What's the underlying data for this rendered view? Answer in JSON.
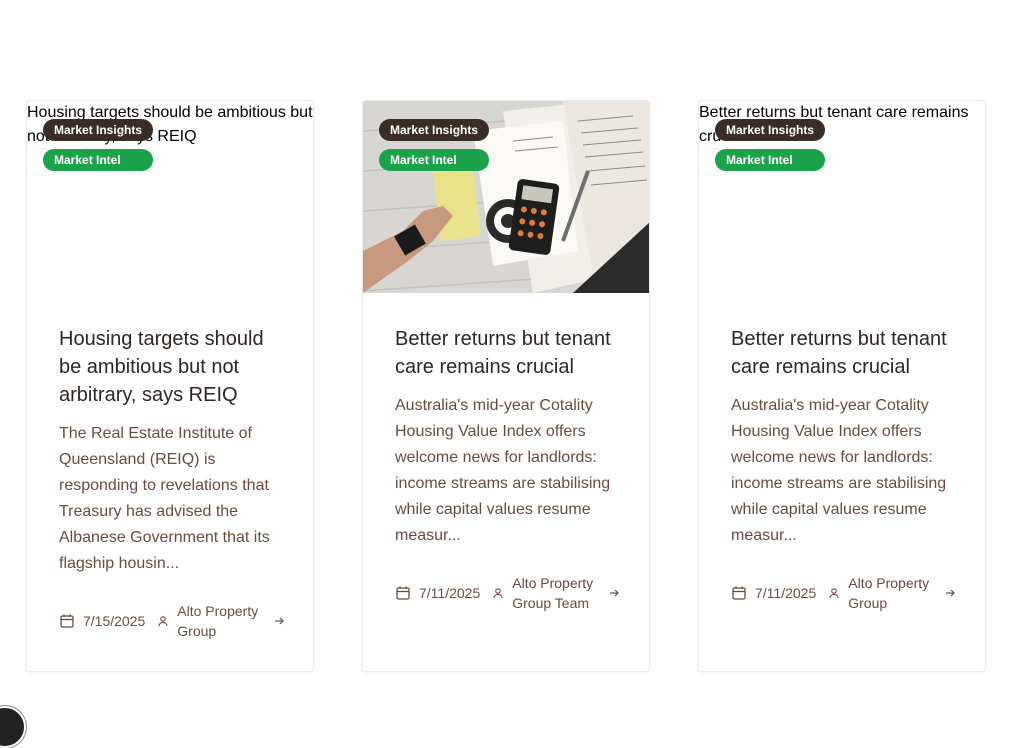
{
  "cards": [
    {
      "image_alt": "Housing targets should be ambitious but not arbitrary, says REIQ",
      "badge_category": "Market Insights",
      "badge_tag": "Market Intel",
      "title": "Housing targets should be ambitious but not arbitrary, says REIQ",
      "excerpt": "The Real Estate Institute of Queensland (REIQ) is responding to revelations that Treasury has advised the Albanese Government that its flagship housin...",
      "date": "7/15/2025",
      "author": "Alto Property Group"
    },
    {
      "image_alt": "",
      "badge_category": "Market Insights",
      "badge_tag": "Market Intel",
      "title": "Better returns but tenant care remains crucial",
      "excerpt": "Australia's mid-year Cotality Housing Value Index offers welcome news for landlords: income streams are stabilising while capital values resume measur...",
      "date": "7/11/2025",
      "author": "Alto Property Group Team"
    },
    {
      "image_alt": "Better returns but tenant care remains crucial",
      "badge_category": "Market Insights",
      "badge_tag": "Market Intel",
      "title": "Better returns but tenant care remains crucial",
      "excerpt": "Australia's mid-year Cotality Housing Value Index offers welcome news for landlords: income streams are stabilising while capital values resume measur...",
      "date": "7/11/2025",
      "author": "Alto Property Group"
    }
  ],
  "colors": {
    "badge_category_bg": "#3a2d27",
    "badge_tag_bg": "#1aa34a",
    "title": "#2e2622",
    "body_text": "#6b4a3e"
  },
  "icons": {
    "date": "calendar-icon",
    "author": "user-icon",
    "more": "arrow-right-icon"
  }
}
